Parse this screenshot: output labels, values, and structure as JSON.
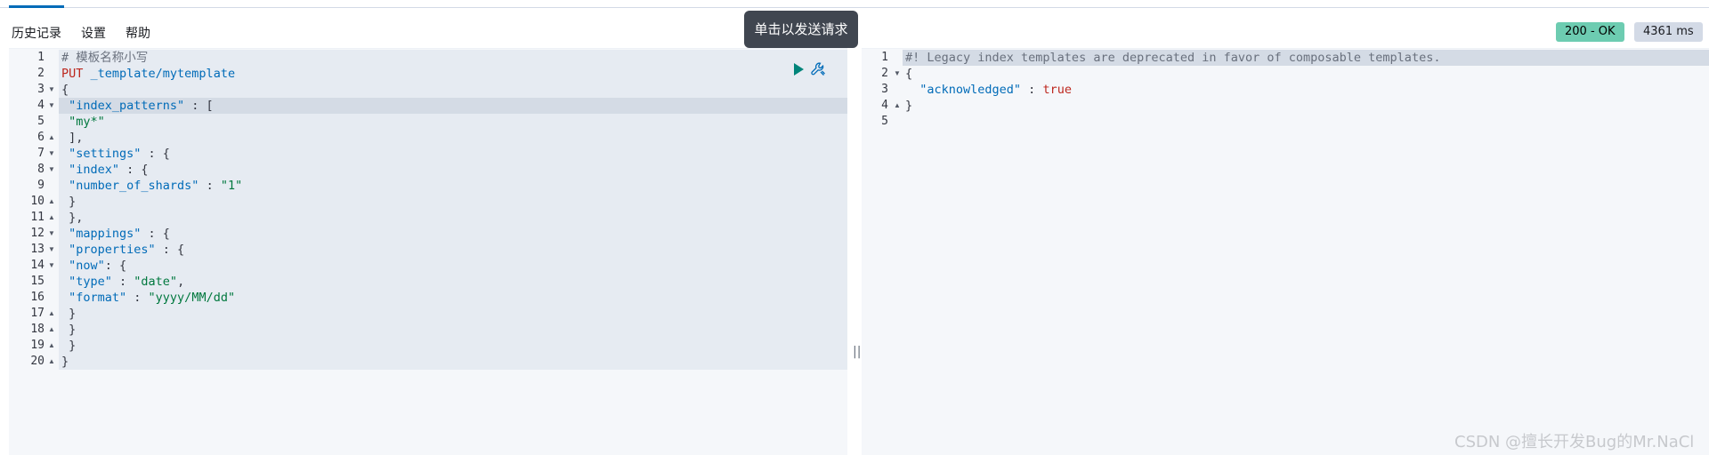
{
  "menu": {
    "history": "历史记录",
    "settings": "设置",
    "help": "帮助"
  },
  "tooltip": "单击以发送请求",
  "status": {
    "code": "200 - OK",
    "time": "4361 ms"
  },
  "request_lines": [
    [
      {
        "t": "# 模板名称小写",
        "c": "c"
      }
    ],
    [
      {
        "t": "PUT",
        "c": "m"
      },
      {
        "t": " _template/mytemplate",
        "c": "k"
      }
    ],
    [
      {
        "t": "{",
        "c": "p"
      }
    ],
    [
      {
        "t": " \"index_patterns\"",
        "c": "k"
      },
      {
        "t": " : [",
        "c": "p"
      }
    ],
    [
      {
        "t": " \"my*\"",
        "c": "s"
      }
    ],
    [
      {
        "t": " ],",
        "c": "p"
      }
    ],
    [
      {
        "t": " \"settings\"",
        "c": "k"
      },
      {
        "t": " : {",
        "c": "p"
      }
    ],
    [
      {
        "t": " \"index\"",
        "c": "k"
      },
      {
        "t": " : {",
        "c": "p"
      }
    ],
    [
      {
        "t": " \"number_of_shards\"",
        "c": "k"
      },
      {
        "t": " : ",
        "c": "p"
      },
      {
        "t": "\"1\"",
        "c": "s"
      }
    ],
    [
      {
        "t": " }",
        "c": "p"
      }
    ],
    [
      {
        "t": " },",
        "c": "p"
      }
    ],
    [
      {
        "t": " \"mappings\"",
        "c": "k"
      },
      {
        "t": " : {",
        "c": "p"
      }
    ],
    [
      {
        "t": " \"properties\"",
        "c": "k"
      },
      {
        "t": " : {",
        "c": "p"
      }
    ],
    [
      {
        "t": " \"now\"",
        "c": "k"
      },
      {
        "t": ": {",
        "c": "p"
      }
    ],
    [
      {
        "t": " \"type\"",
        "c": "k"
      },
      {
        "t": " : ",
        "c": "p"
      },
      {
        "t": "\"date\"",
        "c": "s"
      },
      {
        "t": ",",
        "c": "p"
      }
    ],
    [
      {
        "t": " \"format\"",
        "c": "k"
      },
      {
        "t": " : ",
        "c": "p"
      },
      {
        "t": "\"yyyy/MM/dd\"",
        "c": "s"
      }
    ],
    [
      {
        "t": " }",
        "c": "p"
      }
    ],
    [
      {
        "t": " }",
        "c": "p"
      }
    ],
    [
      {
        "t": " }",
        "c": "p"
      }
    ],
    [
      {
        "t": "}",
        "c": "p"
      }
    ]
  ],
  "request_folds": [
    "",
    "",
    "▼",
    "▼",
    "",
    "▲",
    "▼",
    "▼",
    "",
    "▲",
    "▲",
    "▼",
    "▼",
    "▼",
    "",
    "",
    "▲",
    "▲",
    "▲",
    "▲"
  ],
  "response_lines": [
    [
      {
        "t": "#! Legacy index templates are deprecated in favor of composable templates.",
        "c": "c"
      }
    ],
    [
      {
        "t": "{",
        "c": "p"
      }
    ],
    [
      {
        "t": "  \"acknowledged\"",
        "c": "k"
      },
      {
        "t": " : ",
        "c": "p"
      },
      {
        "t": "true",
        "c": "b"
      }
    ],
    [
      {
        "t": "}",
        "c": "p"
      }
    ],
    [
      {
        "t": "",
        "c": "p"
      }
    ]
  ],
  "response_folds": [
    "",
    "▼",
    "",
    "▲",
    ""
  ],
  "divider_glyph": "||",
  "watermark": "CSDN @擅长开发Bug的Mr.NaCl",
  "icons": {
    "run": "play-icon",
    "settings": "wrench-icon"
  },
  "colors": {
    "accent": "#006bb8",
    "ok_badge": "#6dccb1",
    "string": "#00783e",
    "method": "#bd271e"
  }
}
